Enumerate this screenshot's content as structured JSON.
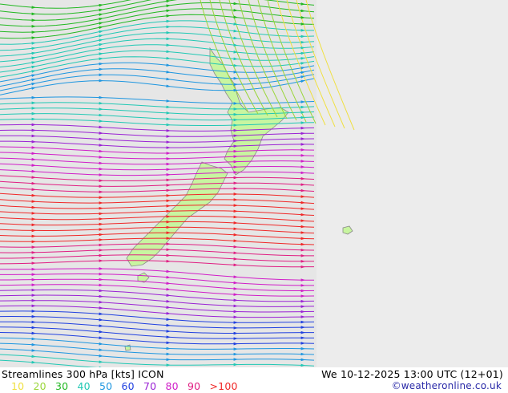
{
  "title": "Streamlines 300 hPa [kts] ICON",
  "datetime": "We 10-12-2025 13:00 UTC (12+01)",
  "credit": "©weatheronline.co.uk",
  "legend": [
    {
      "label": "10",
      "color": "#f0e040"
    },
    {
      "label": "20",
      "color": "#9ad63a"
    },
    {
      "label": "30",
      "color": "#22b822"
    },
    {
      "label": "40",
      "color": "#22c8b4"
    },
    {
      "label": "50",
      "color": "#1e96e0"
    },
    {
      "label": "60",
      "color": "#2040e0"
    },
    {
      "label": "70",
      "color": "#9a22d4"
    },
    {
      "label": "80",
      "color": "#d01ec8"
    },
    {
      "label": "90",
      "color": "#e01e82"
    },
    {
      "label": ">100",
      "color": "#f02828"
    }
  ],
  "colors": {
    "ocean_outside": "#ececec",
    "domain_bg": "#e8e8e8",
    "land": "#c8f5a0",
    "coast": "#888888"
  }
}
